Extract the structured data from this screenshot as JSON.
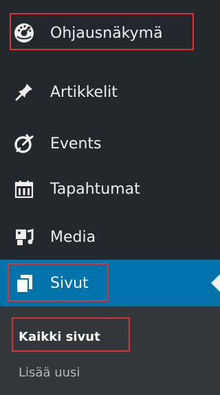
{
  "colors": {
    "menu_background": "#23282d",
    "menu_text": "#eeeeee",
    "current_background": "#0073aa",
    "submenu_background": "#32373c",
    "submenu_text": "#b4b9be",
    "highlight_box": "#dc3232"
  },
  "menu": {
    "items": [
      {
        "label": "Ohjausnäkymä",
        "icon": "dashboard-icon"
      },
      {
        "label": "Artikkelit",
        "icon": "pin-icon"
      },
      {
        "label": "Events",
        "icon": "events-icon"
      },
      {
        "label": "Tapahtumat",
        "icon": "calendar-icon"
      },
      {
        "label": "Media",
        "icon": "media-icon"
      },
      {
        "label": "Sivut",
        "icon": "pages-icon",
        "current": true
      }
    ],
    "submenu": [
      {
        "label": "Kaikki sivut",
        "current": true
      },
      {
        "label": "Lisää uusi"
      }
    ]
  }
}
